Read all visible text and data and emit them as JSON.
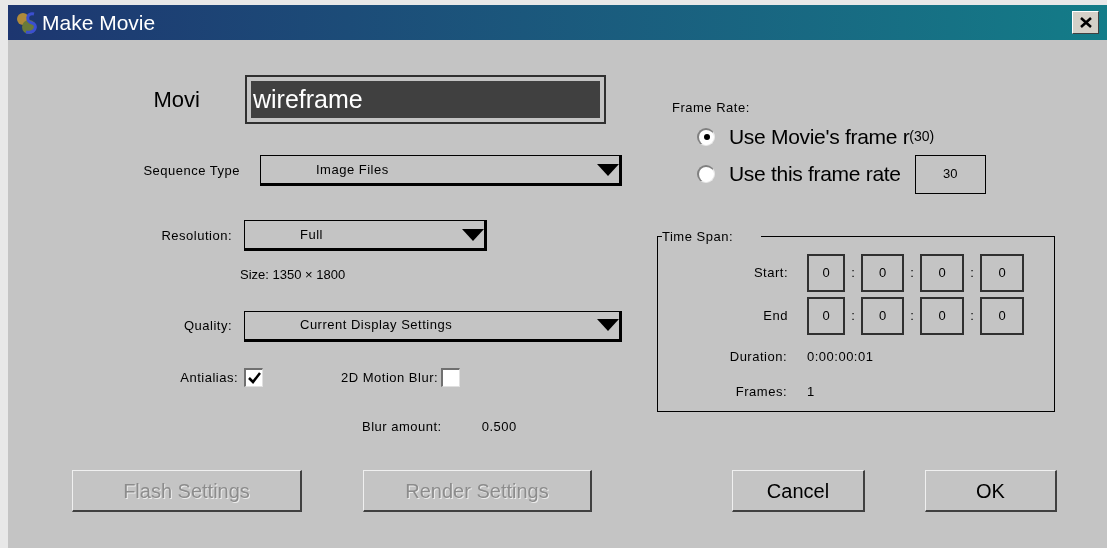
{
  "window": {
    "title": "Make Movie"
  },
  "movie_name": {
    "label": "Movi",
    "value": "wireframe"
  },
  "sequence_type": {
    "label": "Sequence Type",
    "value": "Image Files"
  },
  "resolution": {
    "label": "Resolution:",
    "value": "Full"
  },
  "size": "Size: 1350 × 1800",
  "quality": {
    "label": "Quality:",
    "value": "Current Display Settings"
  },
  "antialias": {
    "label": "Antialias:",
    "checked": true
  },
  "motion_blur": {
    "label": "2D Motion Blur:",
    "checked": false
  },
  "blur_amount": {
    "label": "Blur amount:",
    "value": "0.500"
  },
  "frame_rate": {
    "label": "Frame Rate:",
    "options": [
      {
        "label": "Use Movie's frame r",
        "note": "(30)",
        "selected": true
      },
      {
        "label": "Use this frame rate",
        "value": "30",
        "selected": false
      }
    ]
  },
  "time_span": {
    "title": "Time Span:",
    "rows": [
      {
        "label": "Start:",
        "fields": [
          "0",
          "0",
          "0",
          "0"
        ],
        "separators": [
          ":",
          ":",
          ":"
        ]
      },
      {
        "label": "End",
        "fields": [
          "0",
          "0",
          "0",
          "0"
        ],
        "separators": [
          ":",
          ":",
          ":"
        ]
      }
    ],
    "duration": {
      "label": "Duration:",
      "value": "0:00:00:01"
    },
    "frames": {
      "label": "Frames:",
      "value": "1"
    }
  },
  "buttons": [
    {
      "label": "Flash Settings",
      "disabled": true
    },
    {
      "label": "Render Settings",
      "disabled": true
    },
    {
      "label": "Cancel",
      "disabled": false
    },
    {
      "label": "OK",
      "disabled": false
    }
  ]
}
